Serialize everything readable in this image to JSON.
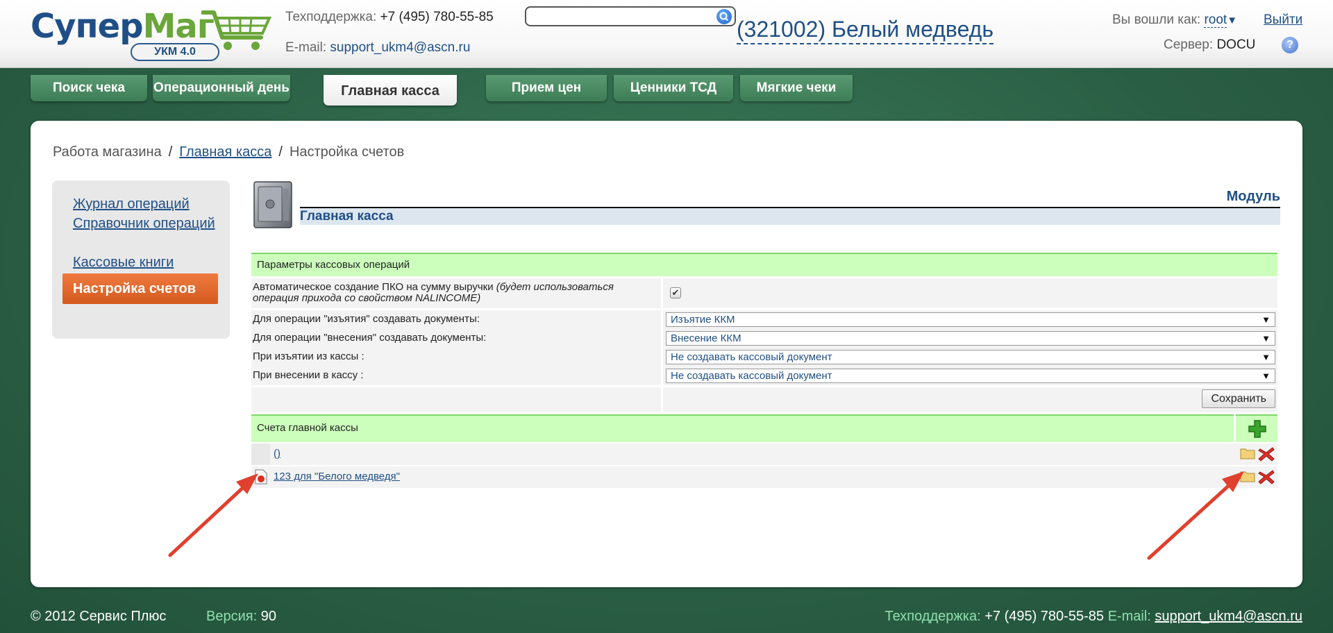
{
  "header": {
    "logo_main": "Супер",
    "logo_accent": "Маг",
    "logo_badge": "УКМ 4.0",
    "support_label": "Техподдержка:",
    "support_phone": "+7 (495) 780-55-85",
    "email_label": "E-mail:",
    "email": "support_ukm4@ascn.ru",
    "search_value": "",
    "store": "(321002) Белый медведь",
    "login_label": "Вы вошли как:",
    "user": "root",
    "logout": "Выйти",
    "server_label": "Сервер:",
    "server": "DOCU",
    "help": "?"
  },
  "tabs": [
    {
      "label": "Поиск чека"
    },
    {
      "label": "Операционный день"
    },
    {
      "label": "Главная касса"
    },
    {
      "label": "Прием цен"
    },
    {
      "label": "Ценники ТСД"
    },
    {
      "label": "Мягкие чеки"
    }
  ],
  "breadcrumb": {
    "root": "Работа магазина",
    "sep": "/",
    "parent": "Главная касса",
    "current": "Настройка счетов"
  },
  "sidenav": [
    {
      "label": "Журнал операций"
    },
    {
      "label": "Справочник операций"
    },
    {
      "label": "Кассовые книги"
    },
    {
      "label": "Настройка счетов"
    }
  ],
  "module": {
    "label": "Модуль",
    "title": "Главная касса"
  },
  "params": {
    "header": "Параметры кассовых операций",
    "auto_pko_label": "Автоматическое создание ПКО на сумму выручки",
    "auto_pko_note": "(будет использоваться операция прихода со свойством NALINCOME)",
    "auto_pko_checked": "✔",
    "rows": [
      {
        "label": "Для операции \"изъятия\" создавать документы:",
        "value": "Изъятие ККМ"
      },
      {
        "label": "Для операции \"внесения\" создавать документы:",
        "value": "Внесение ККМ"
      },
      {
        "label": "При изъятии из кассы :",
        "value": "Не создавать кассовый документ"
      },
      {
        "label": "При внесении в кассу :",
        "value": "Не создавать кассовый документ"
      }
    ],
    "select_arrow": "▼",
    "save": "Сохранить"
  },
  "accounts": {
    "header": "Счета главной кассы",
    "rows": [
      {
        "name": "()"
      },
      {
        "name": "123 для \"Белого медведя\""
      }
    ]
  },
  "footer": {
    "copyright": "© 2012 Сервис Плюс",
    "version_label": "Версия:",
    "version": "90",
    "support_label": "Техподдержка:",
    "support_phone": "+7 (495) 780-55-85",
    "email_label": "E-mail:",
    "email": "support_ukm4@ascn.ru"
  },
  "colors": {
    "brand_blue": "#1f4f86",
    "brand_green": "#6aa63a",
    "active_nav": "#e06a2c",
    "section_green": "#ccffbc",
    "background": "#2f6a4c"
  }
}
